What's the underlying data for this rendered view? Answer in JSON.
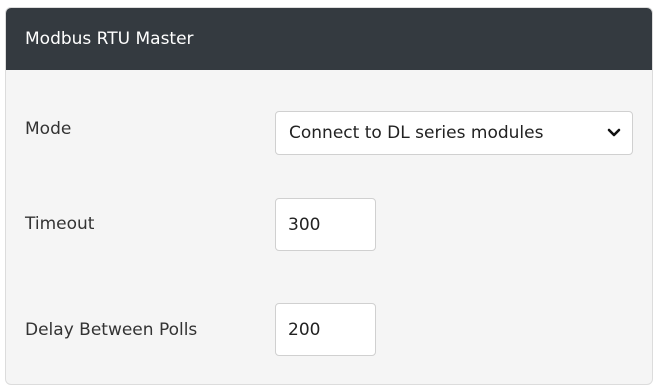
{
  "panel": {
    "title": "Modbus RTU Master"
  },
  "fields": {
    "mode": {
      "label": "Mode",
      "value": "Connect to DL series modules",
      "icon": "chevron-down-icon"
    },
    "timeout": {
      "label": "Timeout",
      "value": "300"
    },
    "delay": {
      "label": "Delay Between Polls",
      "value": "200"
    }
  },
  "colors": {
    "header_bg": "#343a40",
    "panel_bg": "#f5f5f5",
    "input_border": "#d0d0d0"
  }
}
